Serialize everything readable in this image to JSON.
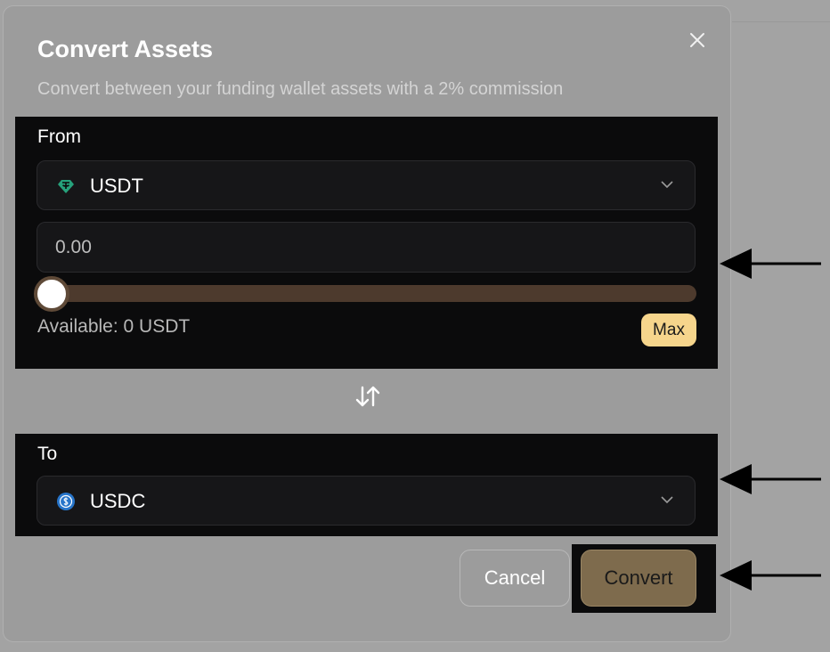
{
  "modal": {
    "title": "Convert Assets",
    "subtitle": "Convert between your funding wallet assets with a 2% commission",
    "close_icon": "close-icon"
  },
  "from": {
    "label": "From",
    "asset": "USDT",
    "asset_icon": "tether-icon",
    "amount_value": "0.00",
    "slider_percent": 0,
    "available": "Available: 0 USDT",
    "max_label": "Max"
  },
  "swap_icon": "swap-arrows-icon",
  "to": {
    "label": "To",
    "asset": "USDC",
    "asset_icon": "usdc-icon"
  },
  "actions": {
    "cancel_label": "Cancel",
    "convert_label": "Convert"
  },
  "colors": {
    "accent": "#f6d58c",
    "panel": "#0b0b0c",
    "convert_button": "#7e6b4d",
    "slider_track": "#4d3a2d"
  }
}
